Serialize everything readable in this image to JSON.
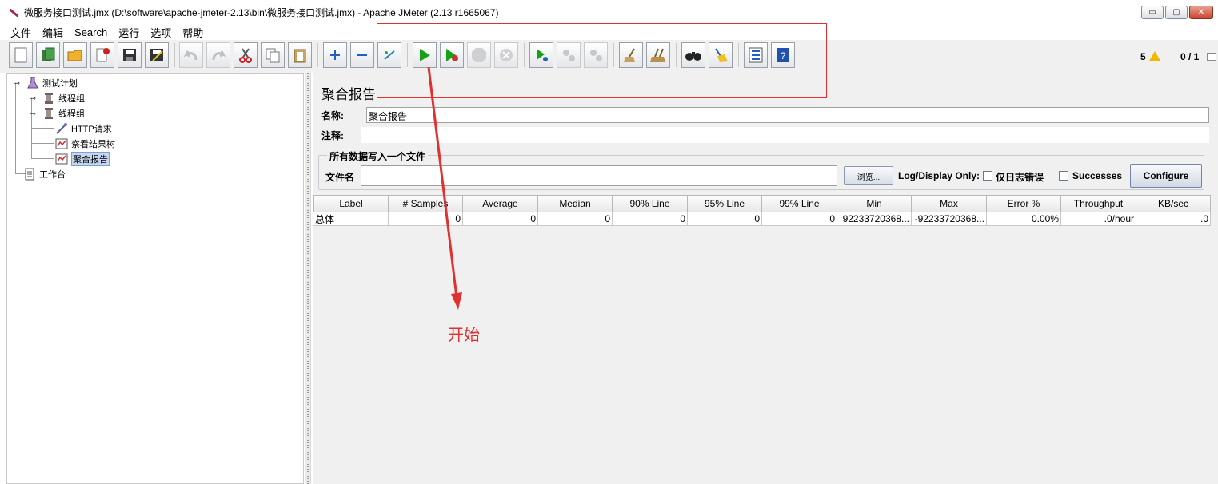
{
  "window": {
    "title": "微服务接口测试.jmx (D:\\software\\apache-jmeter-2.13\\bin\\微服务接口测试.jmx) - Apache JMeter (2.13 r1665067)",
    "minimize": "▭",
    "maximize": "▢",
    "close": "✕"
  },
  "menu": {
    "items": [
      "文件",
      "编辑",
      "Search",
      "运行",
      "选项",
      "帮助"
    ]
  },
  "toolbar": {
    "warning_count": "5",
    "thread_count": "0 / 1"
  },
  "tree": {
    "nodes": [
      {
        "label": "测试计划",
        "icon": "flask-icon"
      },
      {
        "label": "线程组",
        "icon": "spool-icon"
      },
      {
        "label": "线程组",
        "icon": "spool-icon"
      },
      {
        "label": "HTTP请求",
        "icon": "pipette-icon"
      },
      {
        "label": "察看结果树",
        "icon": "chart-icon"
      },
      {
        "label": "聚合报告",
        "icon": "chart-icon"
      },
      {
        "label": "工作台",
        "icon": "notepad-icon"
      }
    ]
  },
  "panel": {
    "title": "聚合报告",
    "name_label": "名称:",
    "name_value": "聚合报告",
    "comment_label": "注释:",
    "comment_value": "",
    "group_title": "所有数据写入一个文件",
    "file_label": "文件名",
    "file_value": "",
    "browse": "浏览...",
    "log_display": "Log/Display Only:",
    "errors_only": "仅日志错误",
    "successes": "Successes",
    "configure": "Configure"
  },
  "table": {
    "columns": [
      "Label",
      "# Samples",
      "Average",
      "Median",
      "90% Line",
      "95% Line",
      "99% Line",
      "Min",
      "Max",
      "Error %",
      "Throughput",
      "KB/sec"
    ],
    "rows": [
      [
        "总体",
        "0",
        "0",
        "0",
        "0",
        "0",
        "0",
        "92233720368...",
        "-92233720368...",
        "0.00%",
        ".0/hour",
        ".0"
      ]
    ]
  },
  "annotation": {
    "text": "开始",
    "color": "#e03030"
  }
}
